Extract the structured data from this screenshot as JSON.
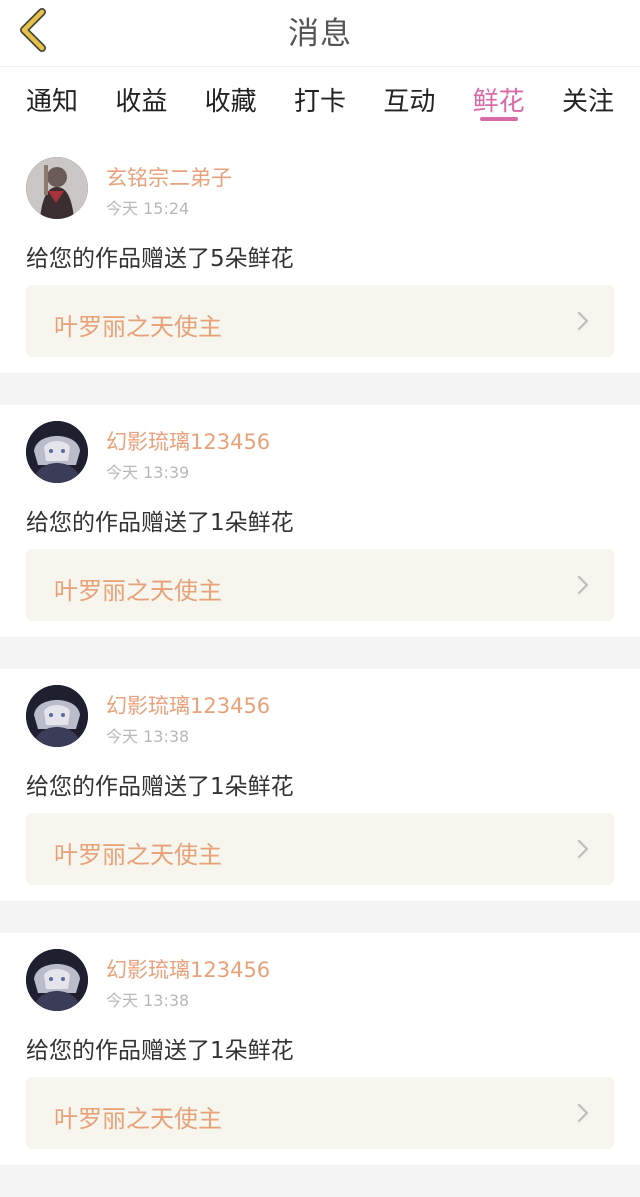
{
  "header": {
    "title": "消息",
    "back_icon": "chevron-left-icon",
    "back_icon_color": "#e7c24a"
  },
  "tabs": [
    {
      "label": "通知",
      "active": false
    },
    {
      "label": "收益",
      "active": false
    },
    {
      "label": "收藏",
      "active": false
    },
    {
      "label": "打卡",
      "active": false
    },
    {
      "label": "互动",
      "active": false
    },
    {
      "label": "鲜花",
      "active": true
    },
    {
      "label": "关注",
      "active": false
    }
  ],
  "colors": {
    "accent_tab": "#d86aa8",
    "username": "#e8a17b",
    "work_title": "#e7a177",
    "work_bg": "#f6f5ee"
  },
  "notifications": [
    {
      "username": "玄铭宗二弟子",
      "time": "今天 15:24",
      "message": "给您的作品赠送了5朵鲜花",
      "work_title": "叶罗丽之天使主",
      "chevron_icon": "chevron-right-icon"
    },
    {
      "username": "幻影琉璃123456",
      "time": "今天 13:39",
      "message": "给您的作品赠送了1朵鲜花",
      "work_title": "叶罗丽之天使主",
      "chevron_icon": "chevron-right-icon"
    },
    {
      "username": "幻影琉璃123456",
      "time": "今天 13:38",
      "message": "给您的作品赠送了1朵鲜花",
      "work_title": "叶罗丽之天使主",
      "chevron_icon": "chevron-right-icon"
    },
    {
      "username": "幻影琉璃123456",
      "time": "今天 13:38",
      "message": "给您的作品赠送了1朵鲜花",
      "work_title": "叶罗丽之天使主",
      "chevron_icon": "chevron-right-icon"
    }
  ]
}
